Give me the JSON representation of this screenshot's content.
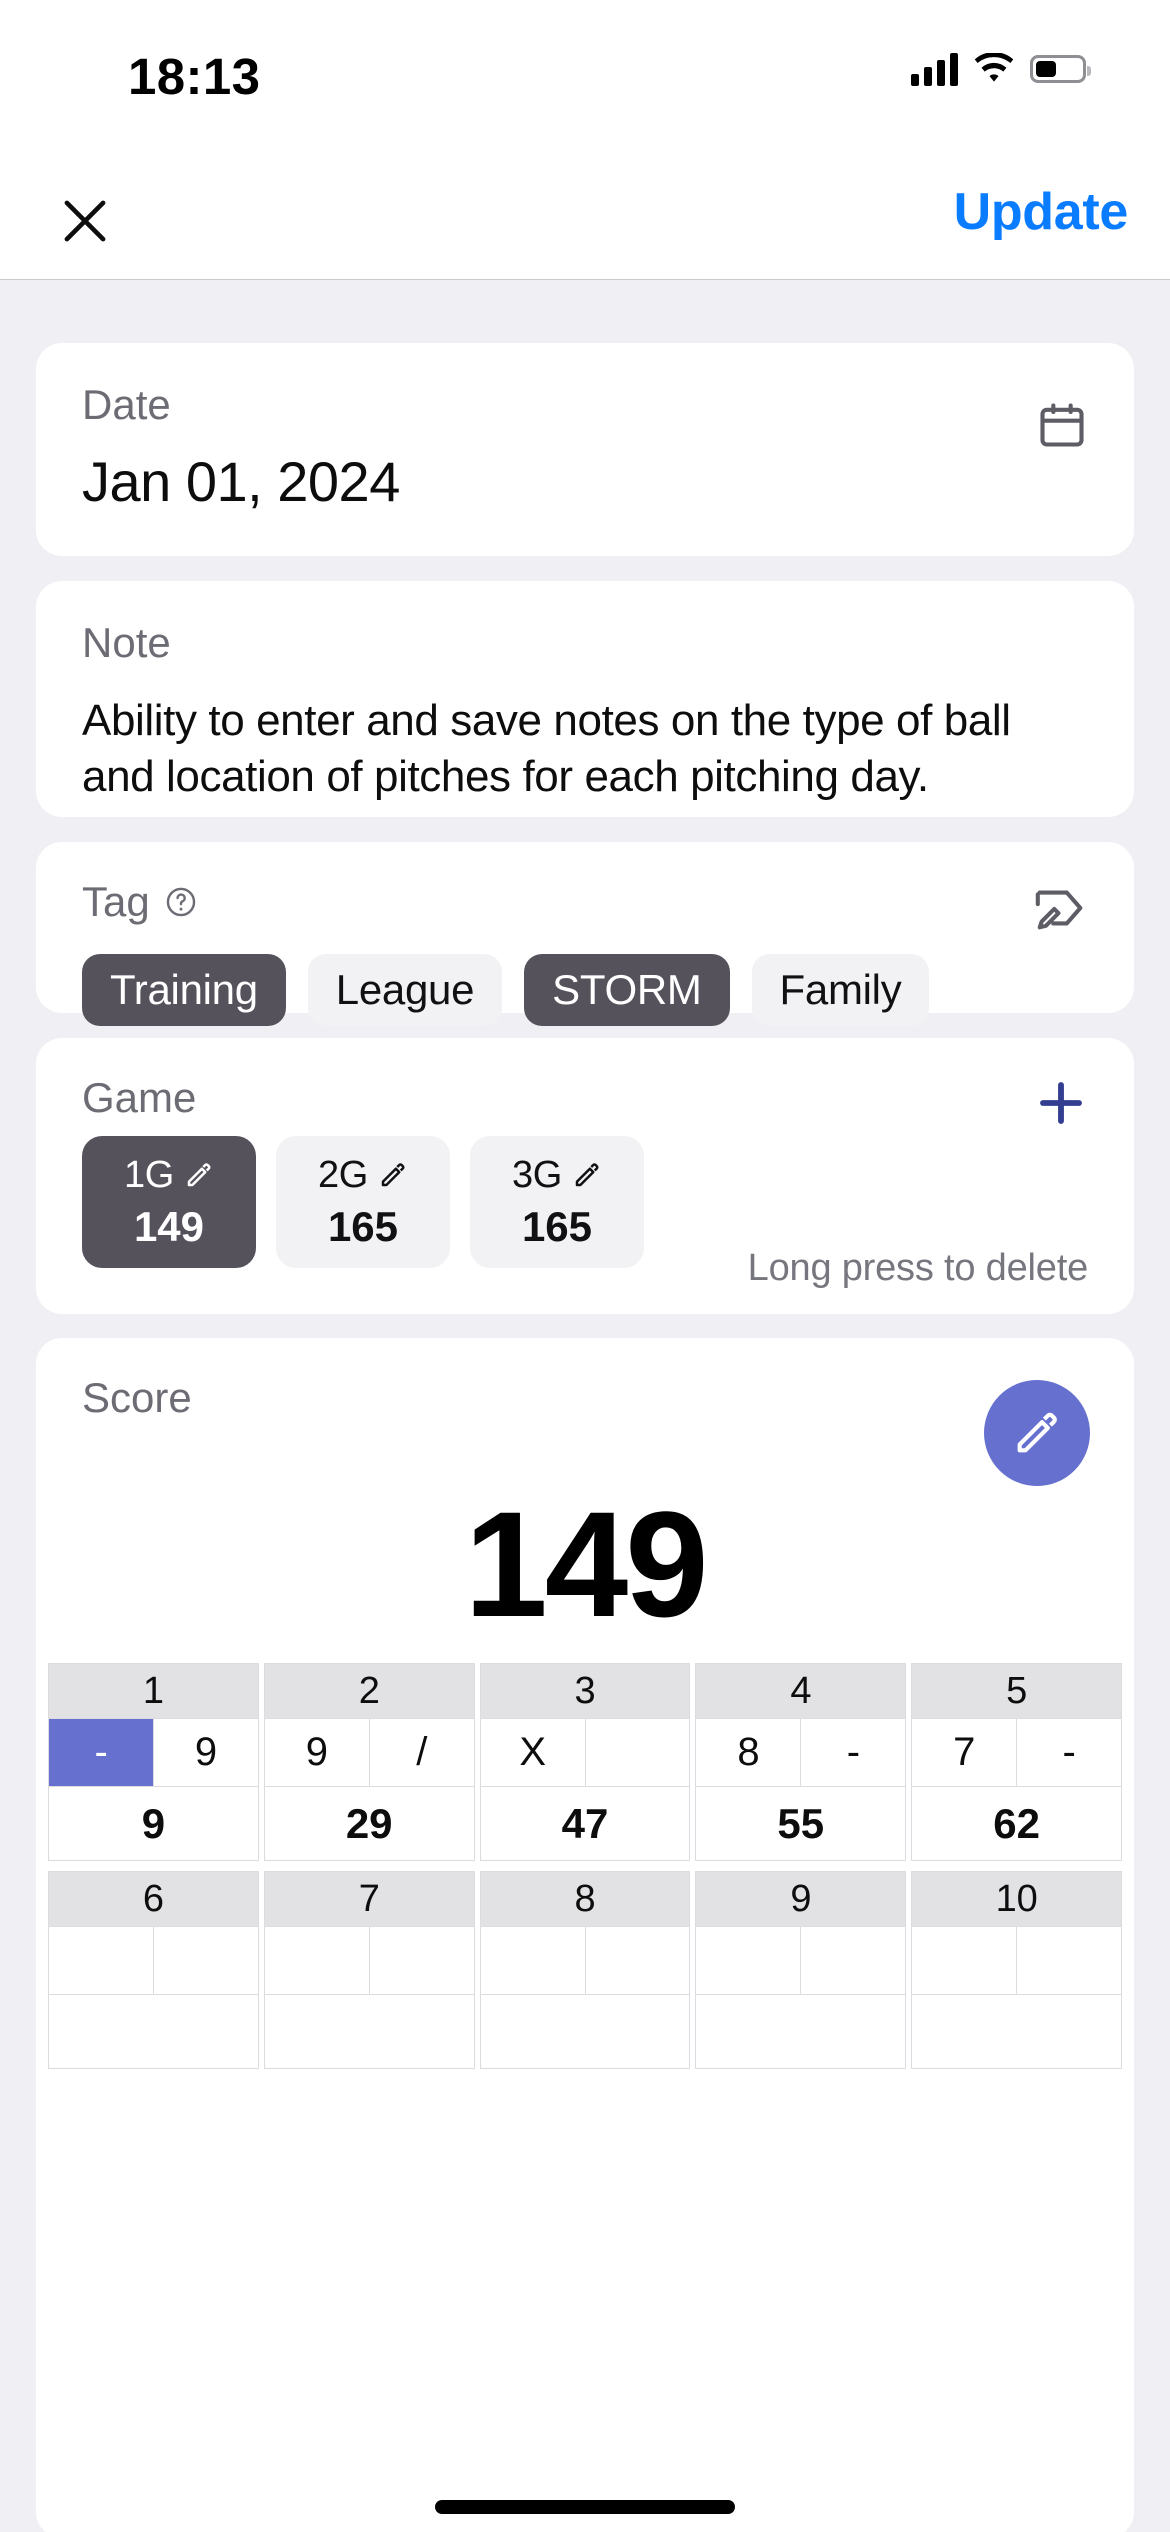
{
  "status_bar": {
    "time": "18:13",
    "signal_icon": "cellular-bars-icon",
    "wifi_icon": "wifi-icon",
    "battery_icon": "battery-icon",
    "battery_percent": 40
  },
  "nav": {
    "close_icon": "close-icon",
    "update_label": "Update",
    "update_color": "#0a7cff"
  },
  "date_section": {
    "label": "Date",
    "value": "Jan 01, 2024",
    "calendar_icon": "calendar-icon"
  },
  "note_section": {
    "label": "Note",
    "text": "Ability to enter and save notes on the type of ball and location of pitches for each pitching day."
  },
  "tag_section": {
    "label": "Tag",
    "help_icon": "question-circle-icon",
    "edit_icon": "tag-edit-icon",
    "chips": [
      {
        "label": "Training",
        "selected": true
      },
      {
        "label": "League",
        "selected": false
      },
      {
        "label": "STORM",
        "selected": true
      },
      {
        "label": "Family",
        "selected": false
      }
    ],
    "selected_color": "#55525c",
    "unselected_color": "#f2f2f5"
  },
  "game_section": {
    "label": "Game",
    "add_icon": "plus-icon",
    "add_icon_color": "#333e91",
    "hint": "Long press to delete",
    "games": [
      {
        "name": "1G",
        "score": "149",
        "selected": true,
        "edit_icon": "pencil-icon"
      },
      {
        "name": "2G",
        "score": "165",
        "selected": false,
        "edit_icon": "pencil-icon"
      },
      {
        "name": "3G",
        "score": "165",
        "selected": false,
        "edit_icon": "pencil-icon"
      }
    ]
  },
  "score_section": {
    "label": "Score",
    "edit_icon": "pencil-icon",
    "edit_button_color": "#6670cf",
    "total": "149",
    "scoresheet": {
      "frames": [
        {
          "number": "1",
          "balls": [
            "-",
            "9"
          ],
          "selected_ball": 0,
          "total": "9"
        },
        {
          "number": "2",
          "balls": [
            "9",
            "/"
          ],
          "selected_ball": -1,
          "total": "29"
        },
        {
          "number": "3",
          "balls": [
            "X",
            ""
          ],
          "selected_ball": -1,
          "total": "47"
        },
        {
          "number": "4",
          "balls": [
            "8",
            "-"
          ],
          "selected_ball": -1,
          "total": "55"
        },
        {
          "number": "5",
          "balls": [
            "7",
            "-"
          ],
          "selected_ball": -1,
          "total": "62"
        }
      ],
      "frames_row2": [
        {
          "number": "6",
          "balls": [
            "",
            ""
          ],
          "selected_ball": -1,
          "total": ""
        },
        {
          "number": "7",
          "balls": [
            "",
            ""
          ],
          "selected_ball": -1,
          "total": ""
        },
        {
          "number": "8",
          "balls": [
            "",
            ""
          ],
          "selected_ball": -1,
          "total": ""
        },
        {
          "number": "9",
          "balls": [
            "",
            ""
          ],
          "selected_ball": -1,
          "total": ""
        },
        {
          "number": "10",
          "balls": [
            "",
            ""
          ],
          "selected_ball": -1,
          "total": ""
        }
      ],
      "selected_cell_color": "#6670cf",
      "header_bg": "#e2e2e4"
    }
  }
}
